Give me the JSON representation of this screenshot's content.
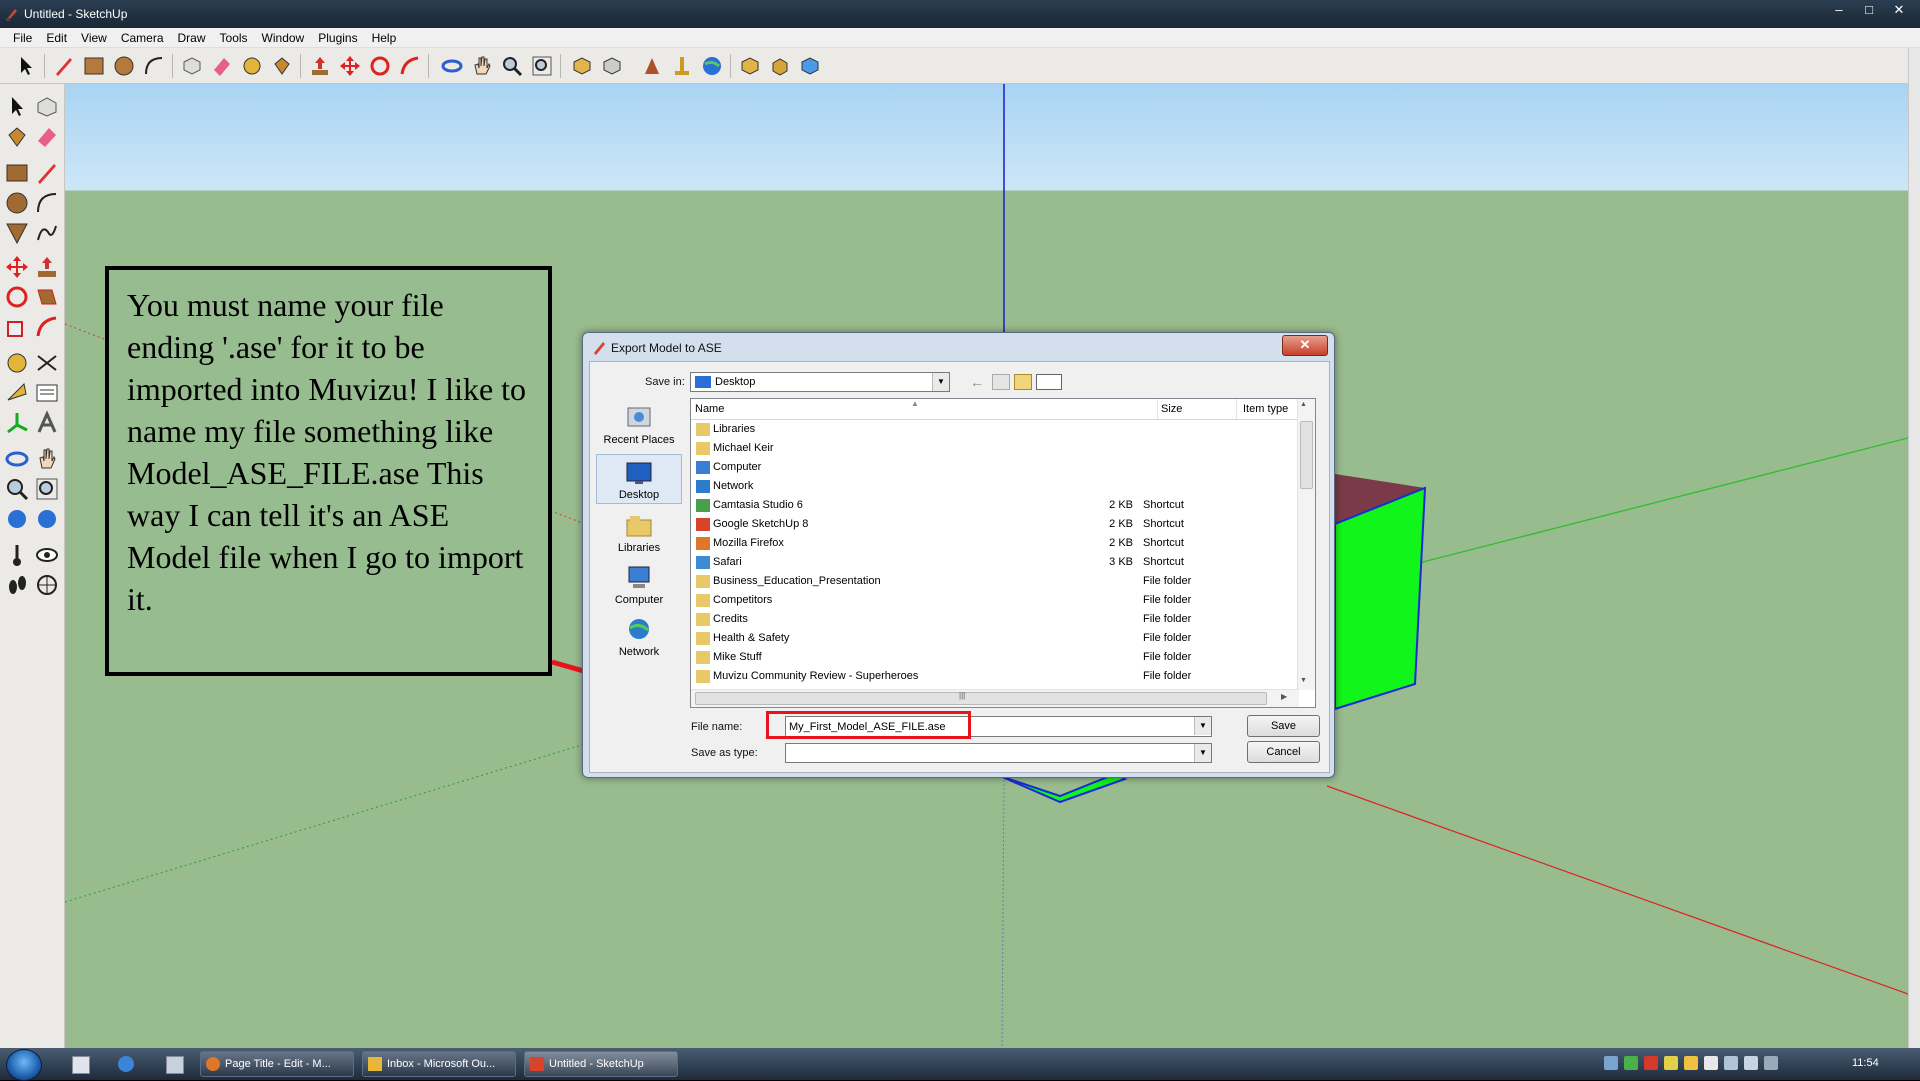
{
  "window": {
    "title": "Untitled - SketchUp",
    "controls": [
      "–",
      "□",
      "✕"
    ]
  },
  "menu": [
    "File",
    "Edit",
    "View",
    "Camera",
    "Draw",
    "Tools",
    "Window",
    "Plugins",
    "Help"
  ],
  "annotation": {
    "text": "You must name your file ending '.ase' for it to be imported into Muvizu! I like to name my file something like Model_ASE_FILE.ase This way I can tell it's an ASE Model file when I go to import it."
  },
  "dialog": {
    "title": "Export Model to ASE",
    "close_label": "✕",
    "save_in_label": "Save in:",
    "save_in_value": "Desktop",
    "places": [
      "Recent Places",
      "Desktop",
      "Libraries",
      "Computer",
      "Network"
    ],
    "columns": {
      "name": "Name",
      "size": "Size",
      "type": "Item type"
    },
    "files": [
      {
        "name": "Libraries",
        "size": "",
        "type": "",
        "icon": "libraries-icon"
      },
      {
        "name": "Michael Keir",
        "size": "",
        "type": "",
        "icon": "user-folder-icon"
      },
      {
        "name": "Computer",
        "size": "",
        "type": "",
        "icon": "computer-icon"
      },
      {
        "name": "Network",
        "size": "",
        "type": "",
        "icon": "network-icon"
      },
      {
        "name": "Camtasia Studio 6",
        "size": "2 KB",
        "type": "Shortcut",
        "icon": "camtasia-icon"
      },
      {
        "name": "Google SketchUp 8",
        "size": "2 KB",
        "type": "Shortcut",
        "icon": "sketchup-icon"
      },
      {
        "name": "Mozilla Firefox",
        "size": "2 KB",
        "type": "Shortcut",
        "icon": "firefox-icon"
      },
      {
        "name": "Safari",
        "size": "3 KB",
        "type": "Shortcut",
        "icon": "safari-icon"
      },
      {
        "name": "Business_Education_Presentation",
        "size": "",
        "type": "File folder",
        "icon": "folder-icon"
      },
      {
        "name": "Competitors",
        "size": "",
        "type": "File folder",
        "icon": "folder-icon"
      },
      {
        "name": "Credits",
        "size": "",
        "type": "File folder",
        "icon": "folder-icon"
      },
      {
        "name": "Health & Safety",
        "size": "",
        "type": "File folder",
        "icon": "folder-icon"
      },
      {
        "name": "Mike Stuff",
        "size": "",
        "type": "File folder",
        "icon": "folder-icon"
      },
      {
        "name": "Muvizu Community Review - Superheroes",
        "size": "",
        "type": "File folder",
        "icon": "folder-icon"
      }
    ],
    "file_name_label": "File name:",
    "file_name_value": "My_First_Model_ASE_FILE.ase",
    "save_as_type_label": "Save as type:",
    "save_as_type_value": "",
    "save_label": "Save",
    "cancel_label": "Cancel",
    "hscroll_grip": "|||"
  },
  "taskbar": {
    "items": [
      "Page Title - Edit - M...",
      "Inbox - Microsoft Ou...",
      "Untitled - SketchUp"
    ],
    "clock": "11:54"
  },
  "colors": {
    "highlight": "#e8141c",
    "sky": "#cde6f8",
    "ground": "#99bc8f",
    "box_front": "#11f51a",
    "box_top": "#7a3a48",
    "box_edge": "#1a2ad6"
  }
}
